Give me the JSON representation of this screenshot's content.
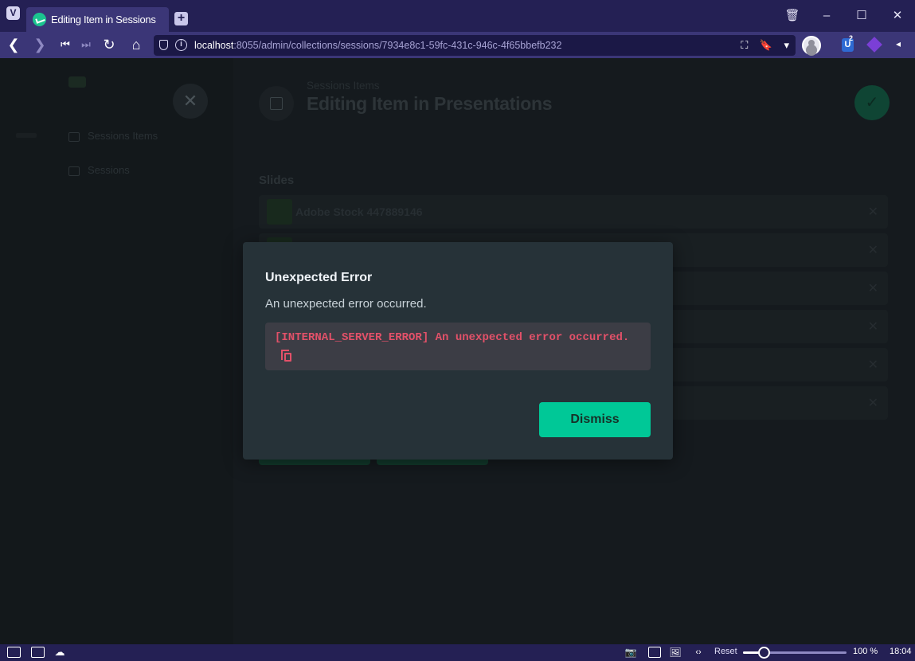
{
  "browser": {
    "tab_title": "Editing Item in Sessions",
    "url_host": "localhost",
    "url_rest": ":8055/admin/collections/sessions/7934e8c1-59fc-431c-946c-4f65bbefb232",
    "extension_badge": "2",
    "ext_letter": "U"
  },
  "app": {
    "breadcrumb": "Sessions Items",
    "page_title": "Editing Item in Presentations",
    "field_label": "Slides",
    "slides": [
      {
        "name": "Adobe Stock 447889146"
      },
      {
        "name": ""
      },
      {
        "name": ""
      },
      {
        "name": ""
      },
      {
        "name": ""
      },
      {
        "name": ""
      }
    ],
    "sidebar_items": [
      "Sessions Items",
      "Sessions"
    ]
  },
  "dialog": {
    "title": "Unexpected Error",
    "message": "An unexpected error occurred.",
    "error_text": "[INTERNAL_SERVER_ERROR] An unexpected error occurred.",
    "dismiss_label": "Dismiss"
  },
  "statusbar": {
    "reset_label": "Reset",
    "zoom_level": "100 %",
    "zoom_value_percent": 20,
    "clock": "18:04"
  },
  "colors": {
    "accent": "#00c897",
    "error": "#e35169",
    "browser_chrome": "#242054"
  }
}
